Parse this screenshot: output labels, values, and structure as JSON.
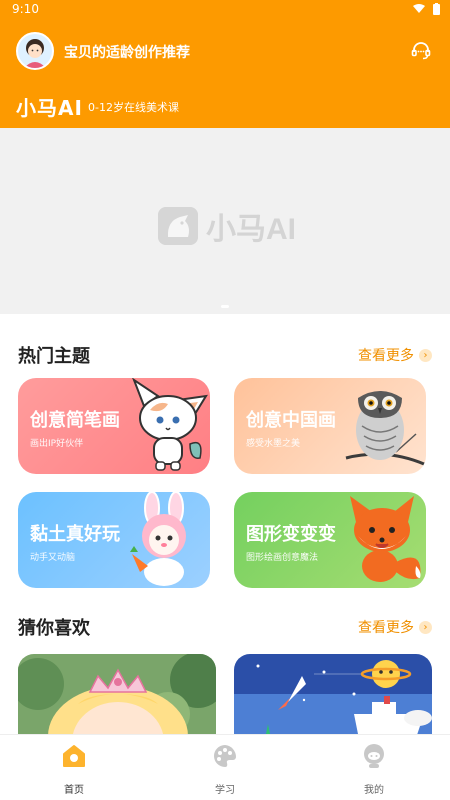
{
  "status": {
    "time": "9:10"
  },
  "header": {
    "greeting": "宝贝的适龄创作推荐",
    "brand": "小马AI",
    "subtitle": "0-12岁在线美术课"
  },
  "banner": {
    "logo_text": "小马AI"
  },
  "hot_topics": {
    "title": "热门主题",
    "more": "查看更多",
    "cards": [
      {
        "title": "创意简笔画",
        "sub": "画出IP好伙伴",
        "color": "#ff8b8b"
      },
      {
        "title": "创意中国画",
        "sub": "感受水墨之美",
        "color": "#ffb98a"
      },
      {
        "title": "黏土真好玩",
        "sub": "动手又动脑",
        "color": "#6db6ff"
      },
      {
        "title": "图形变变变",
        "sub": "图形绘画创意魔法",
        "color": "#8fd36e"
      }
    ]
  },
  "guess": {
    "title": "猜你喜欢",
    "more": "查看更多"
  },
  "tabs": [
    {
      "label": "首页",
      "icon": "home-icon",
      "active": true
    },
    {
      "label": "学习",
      "icon": "palette-icon",
      "active": false
    },
    {
      "label": "我的",
      "icon": "profile-icon",
      "active": false
    }
  ],
  "colors": {
    "accent": "#fd9a00",
    "more_text": "#f09000"
  }
}
